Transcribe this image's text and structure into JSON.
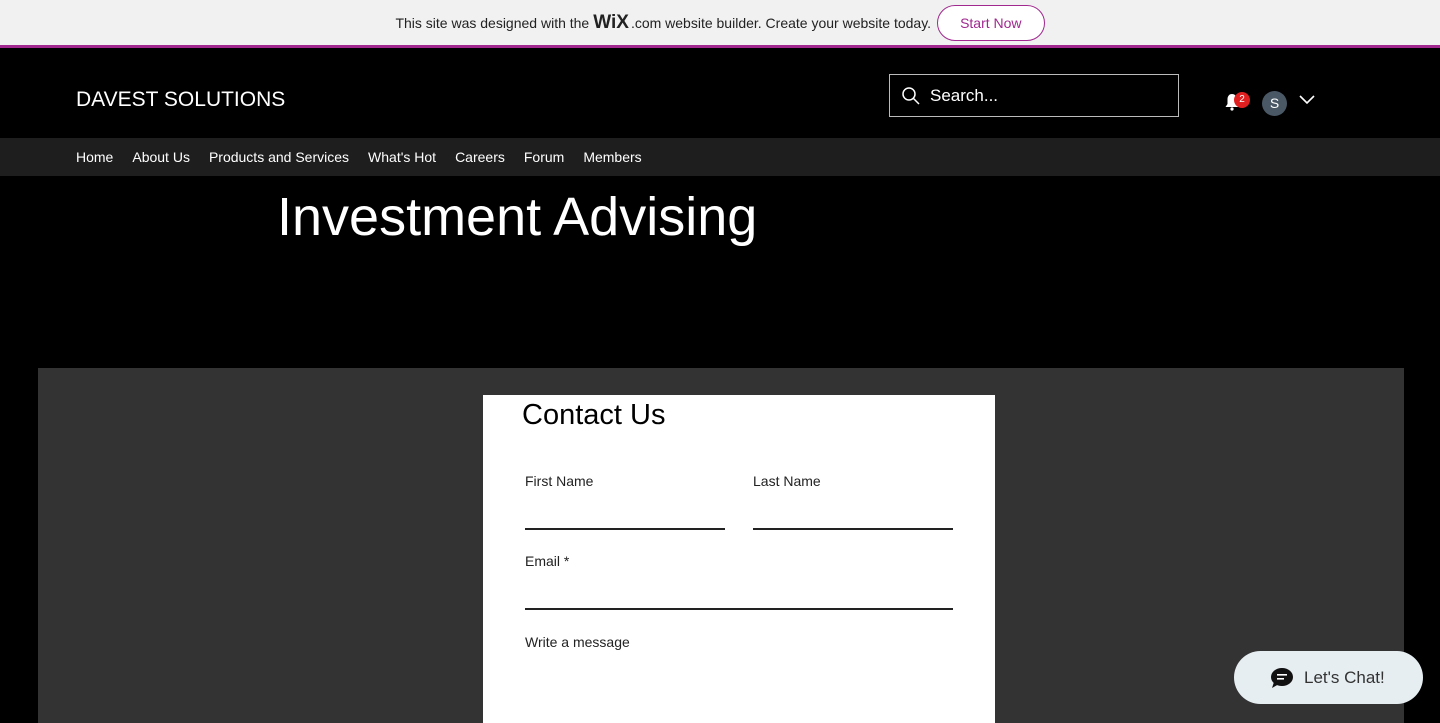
{
  "banner": {
    "text_before": "This site was designed with the",
    "wix": "WiX",
    "text_after": ".com website builder. Create your website today.",
    "cta": "Start Now"
  },
  "header": {
    "logo": "DAVEST SOLUTIONS",
    "search_placeholder": "Search...",
    "notification_count": "2",
    "avatar_initial": "S"
  },
  "nav": {
    "items": [
      "Home",
      "About Us",
      "Products and Services",
      "What's Hot",
      "Careers",
      "Forum",
      "Members"
    ]
  },
  "page": {
    "title": "Investment Advising"
  },
  "form": {
    "title": "Contact Us",
    "first_name": "First Name",
    "last_name": "Last Name",
    "email": "Email *",
    "message": "Write a message"
  },
  "chat": {
    "label": "Let's Chat!"
  },
  "colors": {
    "accent": "#a0288f",
    "badge": "#e02020"
  }
}
